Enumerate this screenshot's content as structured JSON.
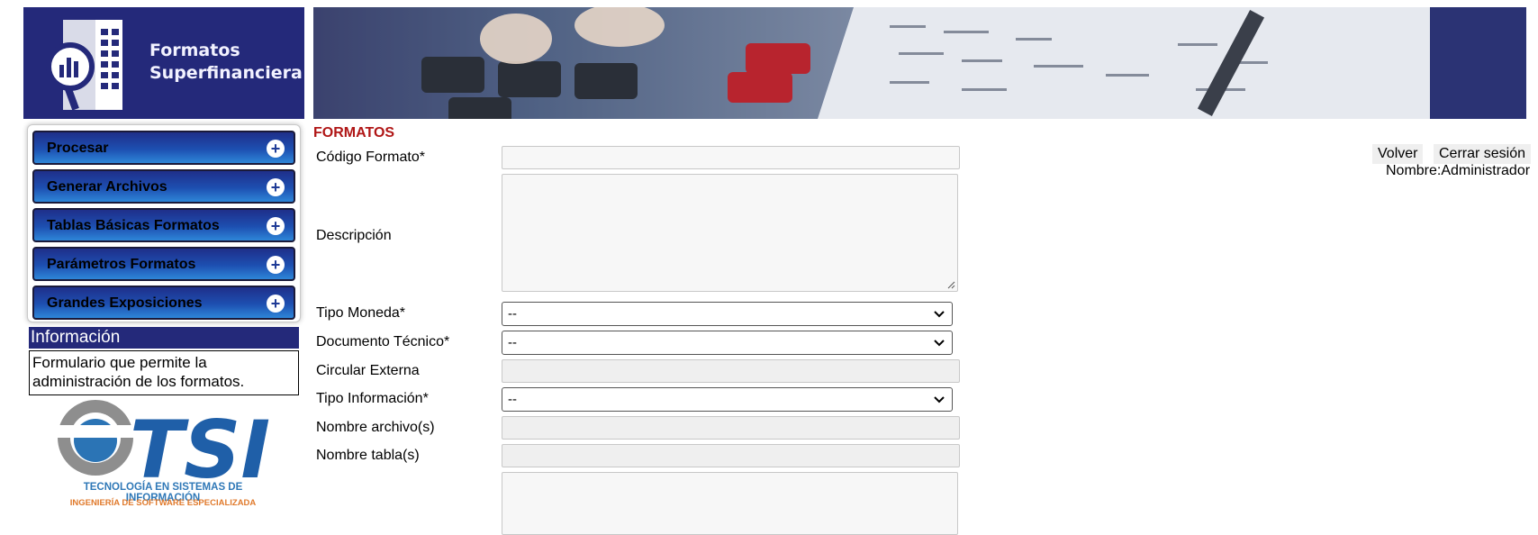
{
  "header": {
    "app_title_line1": "Formatos",
    "app_title_line2": "Superfinanciera",
    "brand_color": "#24297a"
  },
  "sidebar": {
    "items": [
      {
        "label": "Procesar",
        "icon": "plus-circle-icon"
      },
      {
        "label": "Generar Archivos",
        "icon": "plus-circle-icon"
      },
      {
        "label": "Tablas Básicas Formatos",
        "icon": "plus-circle-icon"
      },
      {
        "label": "Parámetros Formatos",
        "icon": "plus-circle-icon"
      },
      {
        "label": "Grandes Exposiciones",
        "icon": "plus-circle-icon"
      }
    ],
    "info_title": "Información",
    "info_text": "Formulario que permite la administración de los formatos."
  },
  "company": {
    "logo_text": "TSI",
    "tagline1": "TECNOLOGÍA EN SISTEMAS DE INFORMACIÓN",
    "tagline2": "INGENIERÍA DE SOFTWARE ESPECIALIZADA"
  },
  "form": {
    "title": "FORMATOS",
    "labels": {
      "codigo": "Código Formato*",
      "descripcion": "Descripción",
      "tipo_moneda": "Tipo Moneda*",
      "documento_tecnico": "Documento Técnico*",
      "circular_externa": "Circular Externa",
      "tipo_informacion": "Tipo Información*",
      "nombre_archivo": "Nombre archivo(s)",
      "nombre_tabla": "Nombre tabla(s)"
    },
    "selects": {
      "tipo_moneda": "--",
      "documento_tecnico": "--",
      "tipo_informacion": "--"
    }
  },
  "toolbar": {
    "volver": "Volver",
    "cerrar_sesion": "Cerrar sesión",
    "user_label": "Nombre:Administrador"
  }
}
